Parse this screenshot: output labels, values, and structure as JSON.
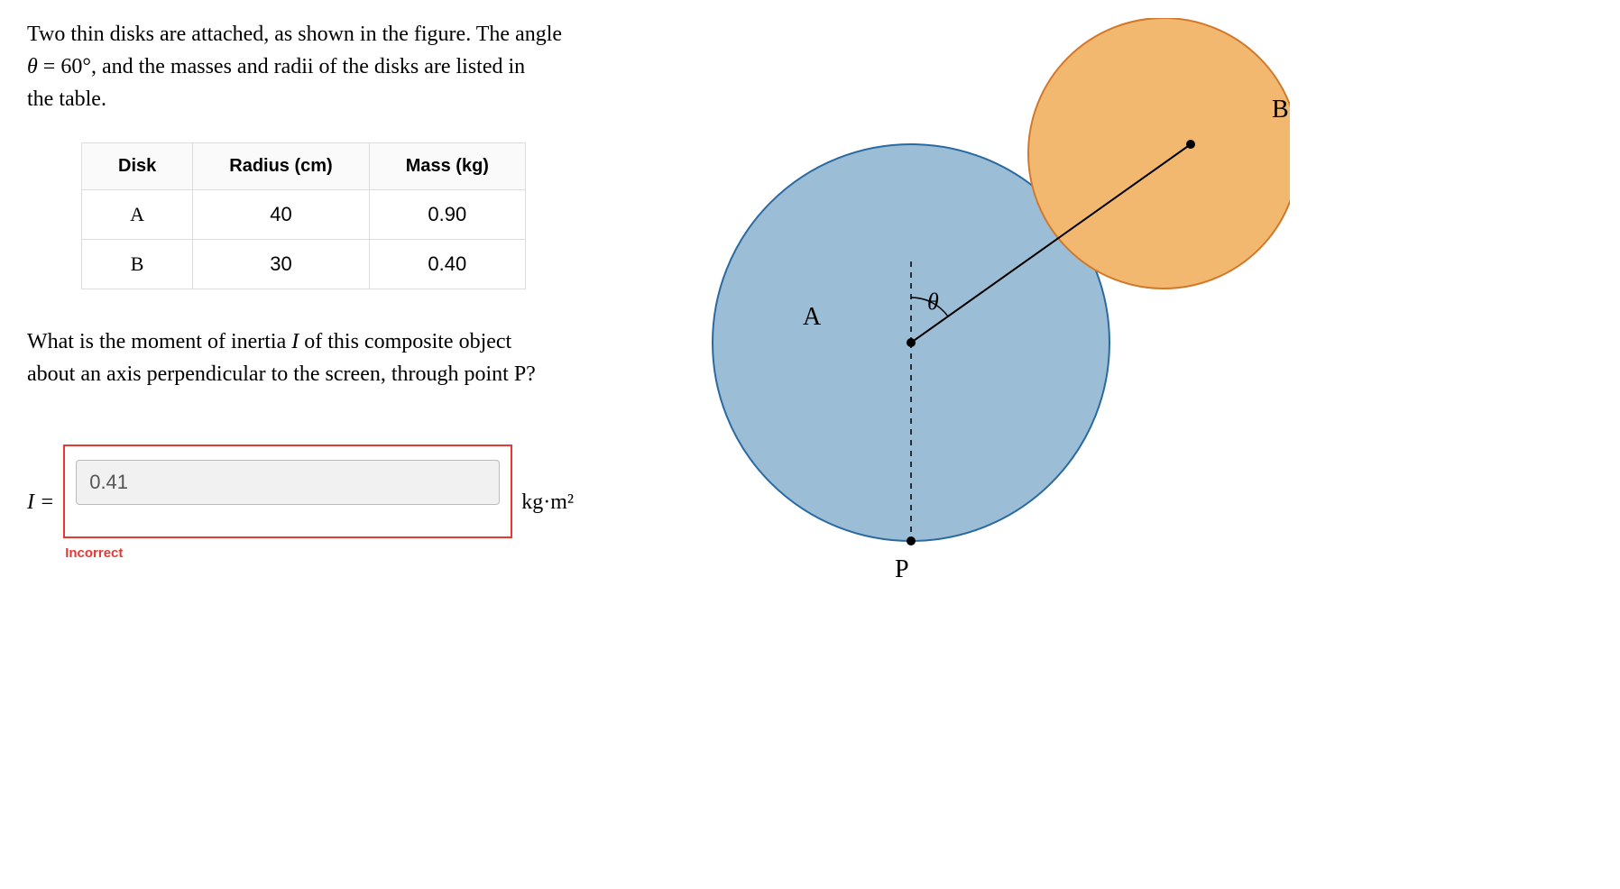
{
  "problem": {
    "line1a": "Two thin disks are attached, as shown in the figure. The angle",
    "theta_var": "θ",
    "equals": " = ",
    "theta_val": "60°",
    "line1b": ", and the masses and radii of the disks are listed in",
    "line1c": "the table."
  },
  "table": {
    "headers": [
      "Disk",
      "Radius (cm)",
      "Mass (kg)"
    ],
    "rows": [
      [
        "A",
        "40",
        "0.90"
      ],
      [
        "B",
        "30",
        "0.40"
      ]
    ]
  },
  "question": {
    "line1a": "What is the moment of inertia ",
    "ivar": "I",
    "line1b": " of this composite object",
    "line2": "about an axis perpendicular to the screen, through point P?"
  },
  "answer": {
    "prefix": "I = ",
    "value": "0.41",
    "units": "kg·m²",
    "feedback": "Incorrect"
  },
  "figure": {
    "labelA": "A",
    "labelB": "B",
    "labelP": "P",
    "theta": "θ"
  }
}
